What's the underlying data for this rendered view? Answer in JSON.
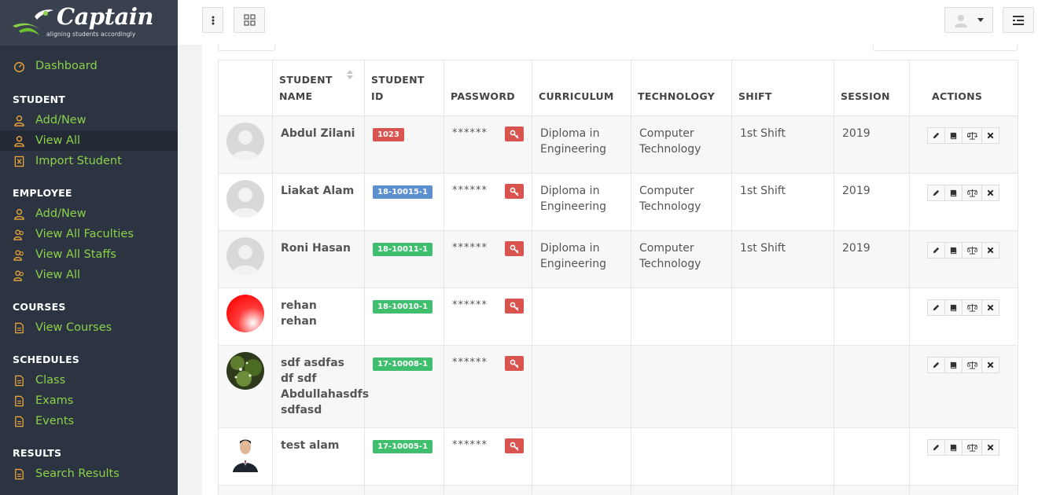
{
  "brand": {
    "title": "Captain",
    "tagline": "aligning students accordingly"
  },
  "sidebar": {
    "dashboard": "Dashboard",
    "sections": {
      "student": {
        "title": "STUDENT",
        "items": [
          "Add/New",
          "View All",
          "Import Student"
        ]
      },
      "employee": {
        "title": "EMPLOYEE",
        "items": [
          "Add/New",
          "View All Faculties",
          "View All Staffs",
          "View All"
        ]
      },
      "courses": {
        "title": "COURSES",
        "items": [
          "View Courses"
        ]
      },
      "schedules": {
        "title": "SCHEDULES",
        "items": [
          "Class",
          "Exams",
          "Events"
        ]
      },
      "results": {
        "title": "RESULTS",
        "items": [
          "Search Results"
        ]
      }
    }
  },
  "table": {
    "headers": [
      "STUDENT NAME",
      "STUDENT ID",
      "PASSWORD",
      "CURRICULUM",
      "TECHNOLOGY",
      "SHIFT",
      "SESSION",
      "ACTIONS"
    ],
    "rows": [
      {
        "name": "Abdul Zilani",
        "id": "1023",
        "password": "******",
        "curriculum": "Diploma in Engineering",
        "technology": "Computer Technology",
        "shift": "1st Shift",
        "session": "2019"
      },
      {
        "name": "Liakat Alam",
        "id": "18-10015-1",
        "password": "******",
        "curriculum": "Diploma in Engineering",
        "technology": "Computer Technology",
        "shift": "1st Shift",
        "session": "2019"
      },
      {
        "name": "Roni Hasan",
        "id": "18-10011-1",
        "password": "******",
        "curriculum": "Diploma in Engineering",
        "technology": "Computer Technology",
        "shift": "1st Shift",
        "session": "2019"
      },
      {
        "name": "rehan rehan",
        "id": "18-10010-1",
        "password": "******",
        "curriculum": "",
        "technology": "",
        "shift": "",
        "session": ""
      },
      {
        "name": "sdf asdfas df sdf Abdullahasdfs sdfasd",
        "id": "17-10008-1",
        "password": "******",
        "curriculum": "",
        "technology": "",
        "shift": "",
        "session": ""
      },
      {
        "name": "test alam",
        "id": "17-10005-1",
        "password": "******",
        "curriculum": "",
        "technology": "",
        "shift": "",
        "session": ""
      }
    ]
  },
  "colors": {
    "accent": "#8bd14a",
    "sidebar_bg": "#2c3441",
    "badge_red": "#d9534f",
    "badge_blue": "#5b8fd0",
    "badge_green": "#3fbe6e"
  },
  "icons": {
    "dashboard": "gauge-icon",
    "user": "user-icon",
    "users": "users-icon",
    "import": "file-excel-icon",
    "file": "file-icon",
    "edit": "pencil-icon",
    "book": "book-icon",
    "balance": "balance-scale-icon",
    "delete": "times-icon",
    "key": "key-icon"
  }
}
